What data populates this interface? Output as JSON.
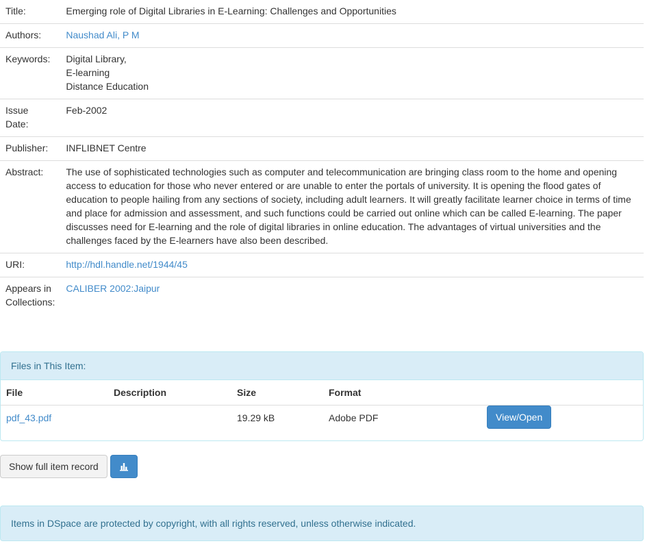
{
  "metadata": {
    "title": {
      "label": "Title:",
      "value": "Emerging role of Digital Libraries in E-Learning: Challenges and Opportunities"
    },
    "authors": {
      "label": "Authors:",
      "value": "Naushad Ali, P M"
    },
    "keywords": {
      "label": "Keywords:",
      "values": [
        "Digital Library,",
        "E-learning",
        "Distance Education"
      ]
    },
    "issue_date": {
      "label_line1": "Issue",
      "label_line2": "Date:",
      "value": "Feb-2002"
    },
    "publisher": {
      "label": "Publisher:",
      "value": "INFLIBNET Centre"
    },
    "abstract": {
      "label": "Abstract:",
      "value": "The use of sophisticated technologies such as computer and telecommunication are bringing class room to the home and opening access to education for those who never entered or are unable to enter the portals of university. It is opening the flood gates of education to people hailing from any sections of society, including adult learners. It will greatly facilitate learner choice in terms of time and place for admission and assessment, and such functions could be carried out online which can be called E-learning. The paper discusses need for E-learning and the role of digital libraries in online education. The advantages of virtual universities and the challenges faced by the E-learners have also been described."
    },
    "uri": {
      "label": "URI:",
      "value": "http://hdl.handle.net/1944/45"
    },
    "collections": {
      "label_line1": "Appears in",
      "label_line2": "Collections:",
      "value": "CALIBER 2002:Jaipur"
    }
  },
  "files": {
    "heading": "Files in This Item:",
    "columns": [
      "File",
      "Description",
      "Size",
      "Format"
    ],
    "rows": [
      {
        "file": "pdf_43.pdf",
        "description": "",
        "size": "19.29 kB",
        "format": "Adobe PDF",
        "action": "View/Open"
      }
    ]
  },
  "actions": {
    "show_full_record": "Show full item record",
    "stats_icon": "bar-chart-icon"
  },
  "footer": {
    "notice": "Items in DSpace are protected by copyright, with all rights reserved, unless otherwise indicated."
  },
  "colors": {
    "link": "#428bca",
    "primary": "#428bca",
    "info_bg": "#d9edf7",
    "info_text": "#31708f"
  }
}
